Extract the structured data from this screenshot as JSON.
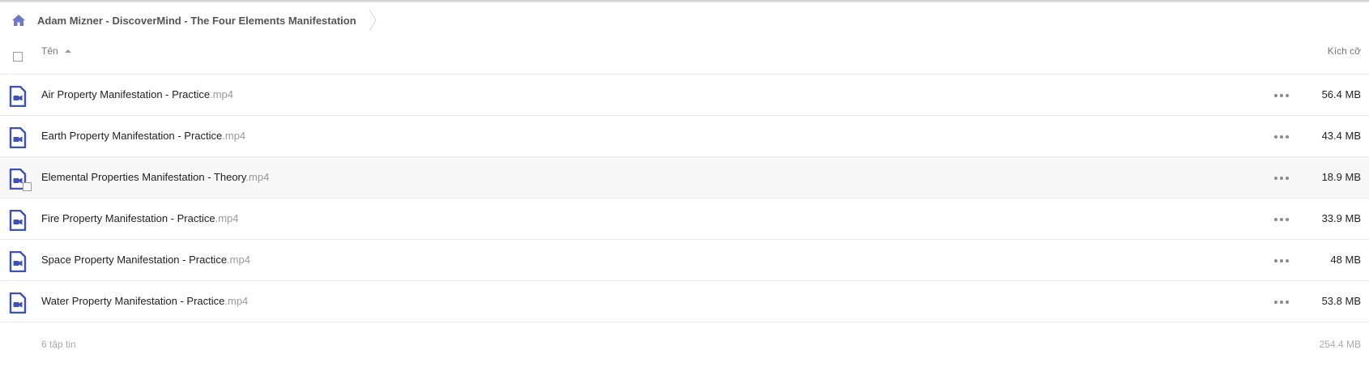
{
  "breadcrumb": {
    "home_icon": "home-icon",
    "current_folder": "Adam Mizner - DiscoverMind - The Four Elements Manifestation"
  },
  "columns": {
    "name_label": "Tên",
    "size_label": "Kích cỡ"
  },
  "files": [
    {
      "name": "Air Property Manifestation - Practice",
      "ext": ".mp4",
      "size": "56.4 MB",
      "icon": "video-file-icon"
    },
    {
      "name": "Earth Property Manifestation - Practice",
      "ext": ".mp4",
      "size": "43.4 MB",
      "icon": "video-file-icon"
    },
    {
      "name": "Elemental Properties Manifestation - Theory",
      "ext": ".mp4",
      "size": "18.9 MB",
      "icon": "video-file-icon"
    },
    {
      "name": "Fire Property Manifestation - Practice",
      "ext": ".mp4",
      "size": "33.9 MB",
      "icon": "video-file-icon"
    },
    {
      "name": "Space Property Manifestation - Practice",
      "ext": ".mp4",
      "size": "48 MB",
      "icon": "video-file-icon"
    },
    {
      "name": "Water Property Manifestation - Practice",
      "ext": ".mp4",
      "size": "53.8 MB",
      "icon": "video-file-icon"
    }
  ],
  "footer": {
    "file_count": "6 tập tin",
    "total_size": "254.4 MB"
  },
  "colors": {
    "icon_accent": "#3f51b5",
    "breadcrumb_home": "#6f7ac4",
    "hover_row": "#f7f7f7",
    "divider": "#e8e8e8"
  }
}
